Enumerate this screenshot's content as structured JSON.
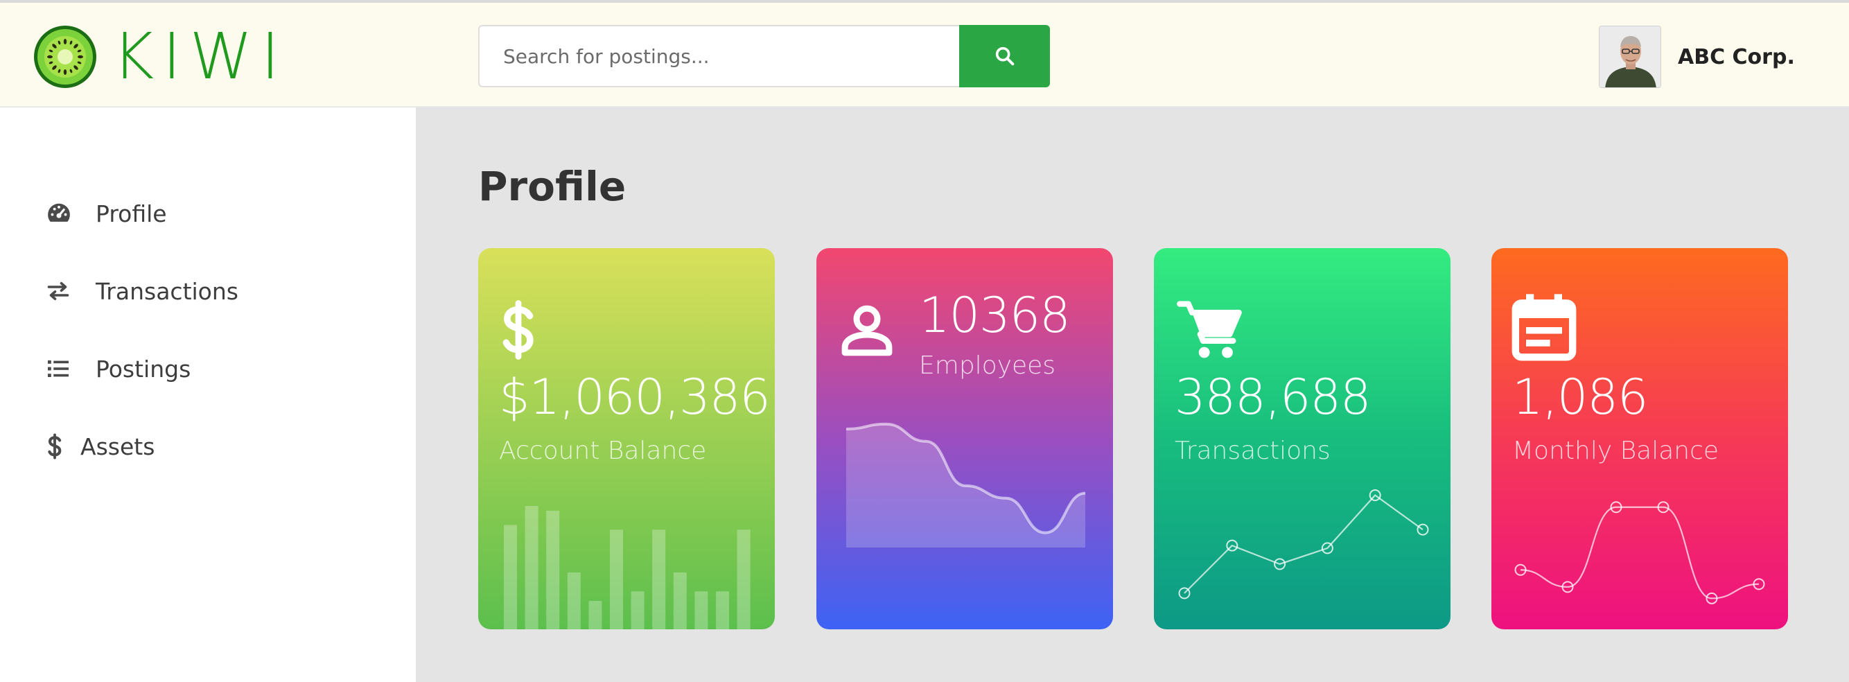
{
  "app": {
    "brand": "KIWI",
    "colors": {
      "brand_green": "#1f9a1f",
      "search_button": "#2aa744",
      "header_bg": "#fdfbee"
    }
  },
  "header": {
    "search": {
      "placeholder": "Search for postings...",
      "value": "",
      "button_icon": "search-icon"
    },
    "user": {
      "company": "ABC Corp.",
      "avatar": "user-avatar"
    }
  },
  "sidebar": {
    "items": [
      {
        "label": "Profile",
        "icon": "dashboard-icon"
      },
      {
        "label": "Transactions",
        "icon": "exchange-icon"
      },
      {
        "label": "Postings",
        "icon": "list-icon"
      },
      {
        "label": "Assets",
        "icon": "dollar-icon"
      }
    ]
  },
  "main": {
    "title": "Profile",
    "cards": [
      {
        "value": "$1,060,386",
        "label": "Account Balance",
        "icon": "dollar-icon",
        "colors": [
          "#d9e05a",
          "#5cbf4d"
        ],
        "bars": [
          22,
          26,
          25,
          12,
          6,
          21,
          8,
          21,
          12,
          8,
          8,
          21
        ]
      },
      {
        "value": "10368",
        "label": "Employees",
        "icon": "user-icon",
        "colors": [
          "#f2476f",
          "#3d63f5"
        ],
        "area": [
          48,
          50,
          43,
          25,
          20,
          6,
          22
        ]
      },
      {
        "value": "388,688",
        "label": "Transactions",
        "icon": "cart-icon",
        "colors": [
          "#34ec80",
          "#0d9986"
        ],
        "points": [
          5,
          23,
          16,
          22,
          42,
          29
        ]
      },
      {
        "value": "1,086",
        "label": "Monthly Balance",
        "icon": "calendar-icon",
        "colors": [
          "#fe6a1f",
          "#ee1180"
        ],
        "points": [
          16,
          10,
          38,
          38,
          6,
          11
        ]
      }
    ]
  }
}
